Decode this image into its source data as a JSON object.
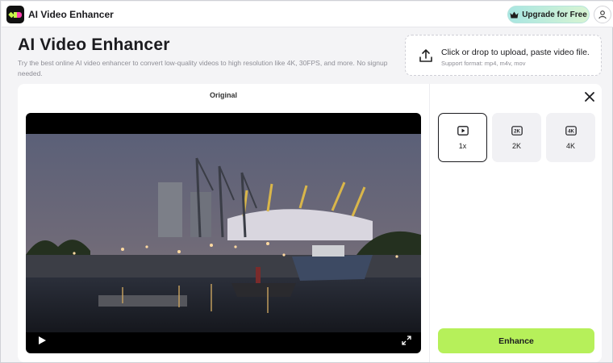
{
  "app": {
    "name": "AI Video Enhancer"
  },
  "header": {
    "upgrade_label": "Upgrade for Free"
  },
  "page": {
    "title": "AI Video Enhancer",
    "description": "Try the best online AI video enhancer to convert low-quality videos to high resolution like 4K, 30FPS, and more. No signup needed."
  },
  "upload": {
    "title": "Click or drop to upload, paste video file.",
    "subtitle": "Support format: mp4, m4v, mov"
  },
  "preview": {
    "label": "Original"
  },
  "options": [
    {
      "label": "1x",
      "icon": "play-icon",
      "selected": true
    },
    {
      "label": "2K",
      "icon": "2k-badge-icon",
      "selected": false
    },
    {
      "label": "4K",
      "icon": "4k-badge-icon",
      "selected": false
    }
  ],
  "enhance_label": "Enhance",
  "colors": {
    "accent": "#b6f05a",
    "upgrade_gradient_start": "#a8e6e2",
    "upgrade_gradient_end": "#d8f4d2"
  }
}
